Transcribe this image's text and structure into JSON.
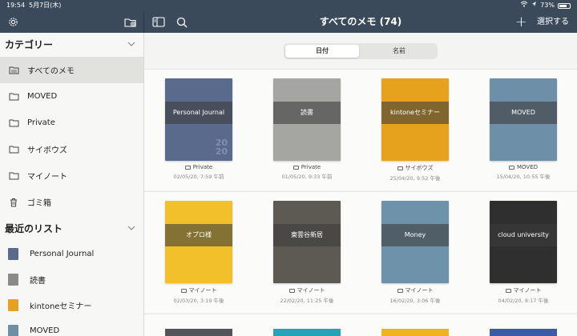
{
  "status": {
    "time": "19:54",
    "date": "5月7日(木)",
    "battery": "73%",
    "battery_level": 0.73
  },
  "header": {
    "title": "すべてのメモ (74)",
    "select_label": "選択する",
    "plus": "+"
  },
  "sidebar": {
    "categories_title": "カテゴリー",
    "categories": [
      {
        "label": "すべてのメモ",
        "icon": "all-notes-icon",
        "active": true
      },
      {
        "label": "MOVED",
        "icon": "folder-icon"
      },
      {
        "label": "Private",
        "icon": "folder-icon"
      },
      {
        "label": "サイボウズ",
        "icon": "folder-icon"
      },
      {
        "label": "マイノート",
        "icon": "folder-icon"
      },
      {
        "label": "ゴミ箱",
        "icon": "trash-icon"
      }
    ],
    "recent_title": "最近のリスト",
    "recent": [
      {
        "label": "Personal Journal",
        "color": "#5b6a8c"
      },
      {
        "label": "読書",
        "color": "#8a8a88"
      },
      {
        "label": "kintoneセミナー",
        "color": "#e5a11f"
      },
      {
        "label": "MOVED",
        "color": "#6e8fa6"
      }
    ]
  },
  "sort": {
    "date_label": "日付",
    "name_label": "名前"
  },
  "notes_row1": [
    {
      "title": "Personal Journal",
      "folder": "Private",
      "date": "02/05/20, 7:59 午前",
      "cover": "#5a6a8d",
      "extra": "2020"
    },
    {
      "title": "読書",
      "folder": "Private",
      "date": "01/05/20, 9:33 午前",
      "cover": "#a5a6a2"
    },
    {
      "title": "kintoneセミナー",
      "folder": "サイボウズ",
      "date": "25/04/20, 9:52 午後",
      "cover": "#e6a21d"
    },
    {
      "title": "MOVED",
      "folder": "MOVED",
      "date": "15/04/20, 10:55 午後",
      "cover": "#6e8fa8"
    }
  ],
  "notes_row2": [
    {
      "title": "オプロ様",
      "folder": "マイノート",
      "date": "02/03/20, 3:19 午後",
      "cover": "#f1c02a"
    },
    {
      "title": "東雲谷新居",
      "folder": "マイノート",
      "date": "22/02/20, 11:25 午後",
      "cover": "#5d5a53"
    },
    {
      "title": "Money",
      "folder": "マイノート",
      "date": "16/02/20, 3:06 午後",
      "cover": "#6f92ab"
    },
    {
      "title": "cloud university",
      "folder": "マイノート",
      "date": "04/02/20, 8:17 午後",
      "cover": "#2f2f2f"
    }
  ]
}
